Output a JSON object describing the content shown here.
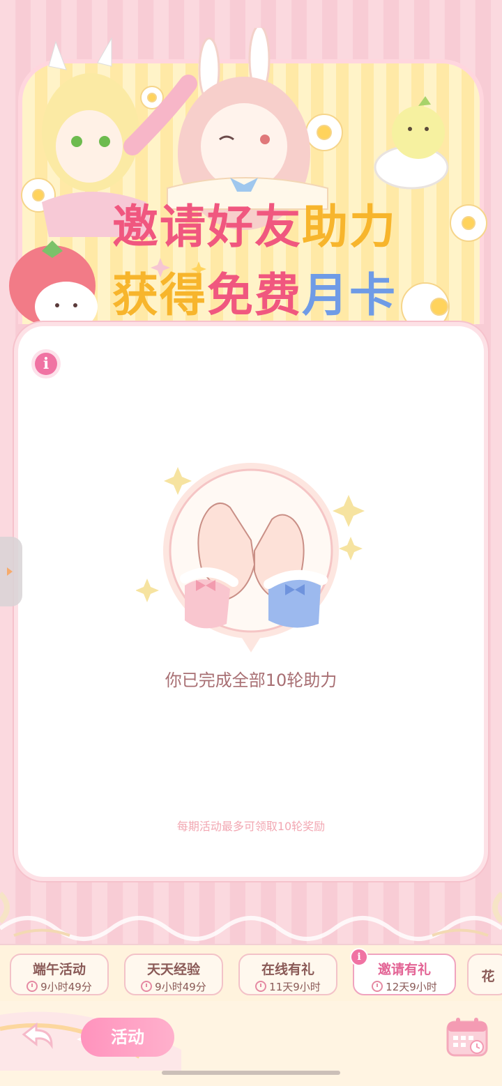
{
  "banner": {
    "title_line1": [
      {
        "text": "邀请好友",
        "color": "#f0577f"
      },
      {
        "text": "助力",
        "color": "#f7b52c"
      }
    ],
    "title_line2": [
      {
        "text": "获得",
        "color": "#f7b52c"
      },
      {
        "text": "免费",
        "color": "#f0577f"
      },
      {
        "text": "月卡",
        "color": "#6f9be6"
      }
    ]
  },
  "panel": {
    "info_icon": "i",
    "completion_text": "你已完成全部10轮助力",
    "note_text": "每期活动最多可领取10轮奖励"
  },
  "tabs": [
    {
      "label": "端午活动",
      "timer": "9小时49分",
      "active": false
    },
    {
      "label": "天天经验",
      "timer": "9小时49分",
      "active": false
    },
    {
      "label": "在线有礼",
      "timer": "11天9小时",
      "active": false
    },
    {
      "label": "邀请有礼",
      "timer": "12天9小时",
      "active": true,
      "badge": "i"
    },
    {
      "label": "花",
      "timer": "",
      "active": false
    }
  ],
  "bottom": {
    "activity_label": "活动",
    "back_icon": "back-arrow-icon",
    "calendar_icon": "calendar-icon"
  },
  "colors": {
    "accent_pink": "#f073a3",
    "title_pink": "#f0577f",
    "title_yellow": "#f7b52c",
    "title_blue": "#6f9be6",
    "text_brown": "#a86f73"
  }
}
